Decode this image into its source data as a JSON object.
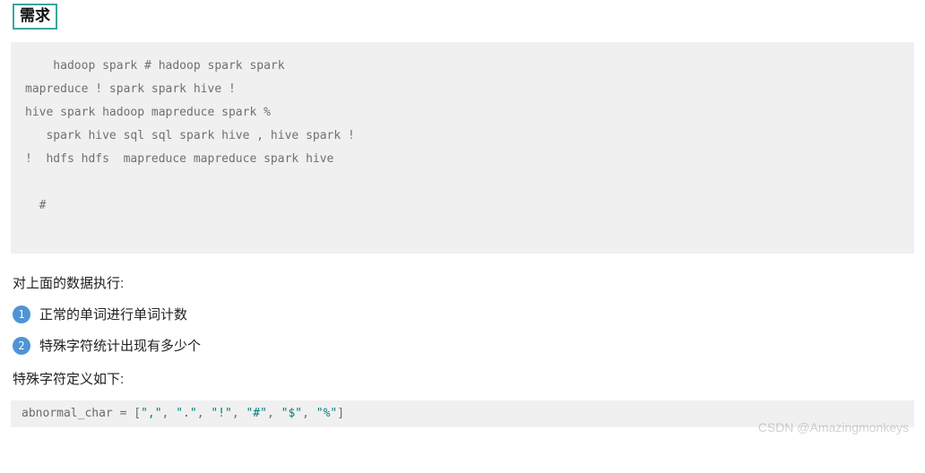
{
  "heading": "需求",
  "code_block_1": {
    "lines": [
      "    hadoop spark # hadoop spark spark",
      "mapreduce ! spark spark hive !",
      "hive spark hadoop mapreduce spark %",
      "   spark hive sql sql spark hive , hive spark !",
      "!  hdfs hdfs  mapreduce mapreduce spark hive",
      "",
      "  #",
      "",
      ""
    ]
  },
  "intro_text": "对上面的数据执行:",
  "list_items": [
    {
      "n": "1",
      "text": "正常的单词进行单词计数"
    },
    {
      "n": "2",
      "text": "特殊字符统计出现有多少个"
    }
  ],
  "subheading": "特殊字符定义如下:",
  "code_block_2": {
    "ident": "abnormal_char",
    "op": " = ",
    "open": "[",
    "items": [
      "\",\"",
      "\".\"",
      "\"!\"",
      "\"#\"",
      "\"$\"",
      "\"%\""
    ],
    "sep": ", ",
    "close": "]"
  },
  "watermark": "CSDN @Amazingmonkeys"
}
